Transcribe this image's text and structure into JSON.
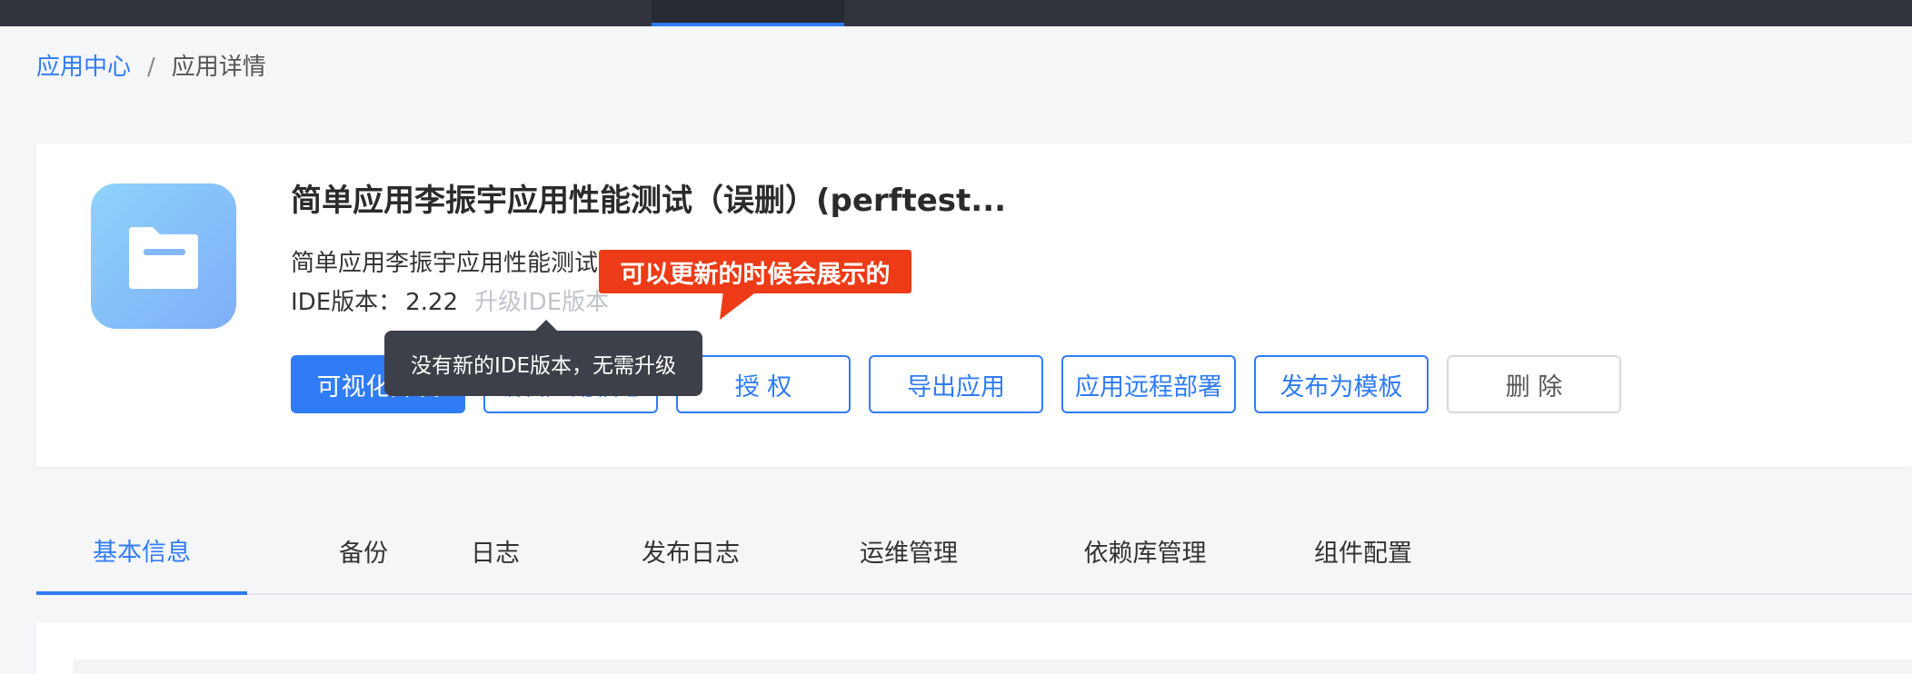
{
  "breadcrumb": {
    "home": "应用中心",
    "separator": "/",
    "current": "应用详情"
  },
  "app": {
    "icon": "folder-icon",
    "title": "简单应用李振宇应用性能测试（误删）(perftest...",
    "description": "简单应用李振宇应用性能测试",
    "ide_label": "IDE版本：",
    "ide_version": "2.22",
    "upgrade_label": "升级IDE版本"
  },
  "buttons": {
    "visual_dev": "可视化开发",
    "edit_info": "编辑应用信息",
    "authorize": "授 权",
    "export": "导出应用",
    "remote_deploy": "应用远程部署",
    "publish_template": "发布为模板",
    "delete": "删 除"
  },
  "tooltip": "没有新的IDE版本，无需升级",
  "callout": "可以更新的时候会展示的",
  "tabs": [
    "基本信息",
    "备份",
    "日志",
    "发布日志",
    "运维管理",
    "依赖库管理",
    "组件配置"
  ],
  "active_tab": "基本信息",
  "colors": {
    "accent": "#2f7cf6",
    "topbar": "#31343d",
    "callout": "#ec3b16",
    "tooltip": "#3d4048"
  }
}
